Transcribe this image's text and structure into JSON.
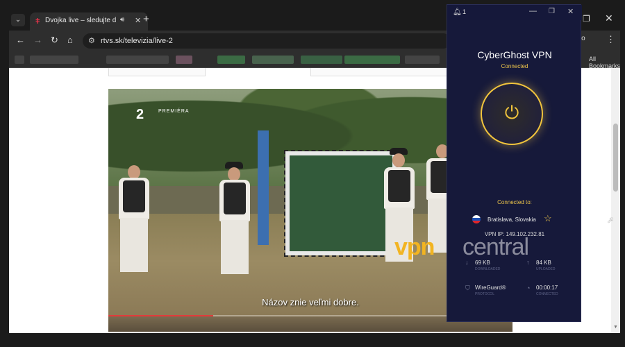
{
  "browser": {
    "tab": {
      "title": "Dvojka live – sledujte druhý",
      "favicon": "rtvs-favicon"
    },
    "new_tab": "+",
    "tab_list": "⌄",
    "window_controls": {
      "restore": "❐",
      "close": "✕"
    },
    "nav": {
      "back": "←",
      "forward": "→",
      "reload": "↻",
      "home": "⌂"
    },
    "url": "rtvs.sk/televizia/live-2",
    "incognito_label": "gnito",
    "menu": "⋮",
    "all_bookmarks": "All Bookmarks"
  },
  "video": {
    "channel_logo": "2",
    "badge": "PREMIÉRA",
    "subtitle": "Názov znie veľmi dobre.",
    "progress": 0.26
  },
  "vpn": {
    "notification_count": "1",
    "app_name": "CyberGhost VPN",
    "status": "Connected",
    "power_icon": "power-icon",
    "connected_to_label": "Connected to:",
    "location": "Bratislava, Slovakia",
    "ip": "VPN IP: 149.102.232.81",
    "download": "69 KB",
    "download_sub": "DOWNLOADED",
    "upload": "84 KB",
    "upload_sub": "UPLOADED",
    "protocol": "WireGuard®",
    "protocol_sub": "PROTOCOL",
    "duration": "00:00:17",
    "duration_sub": "CONNECTED",
    "colors": {
      "accent": "#f2c53d",
      "bg": "#16193a"
    }
  },
  "watermark": {
    "vpn": "vpn",
    "central": "central"
  }
}
